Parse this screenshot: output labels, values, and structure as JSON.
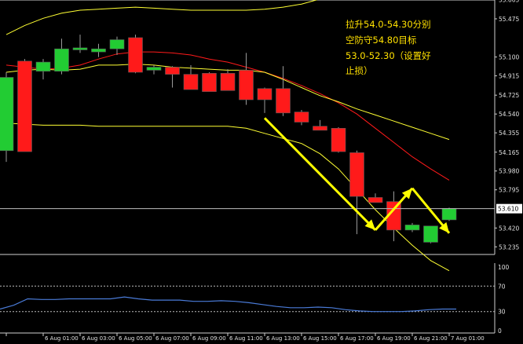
{
  "annotation": {
    "lines": [
      "拉升54.0-54.30分别",
      "空防守54.80目标",
      "53.0-52.30（设置好",
      "止损）"
    ],
    "color": "#ffe000"
  },
  "chart_data": {
    "type": "candlestick",
    "ylim": [
      53.16,
      55.66
    ],
    "price_ticks": [
      "55.665",
      "55.475",
      "55.100",
      "54.915",
      "54.725",
      "54.540",
      "54.355",
      "54.165",
      "53.980",
      "53.795",
      "53.610",
      "53.420",
      "53.235"
    ],
    "current_price": "53.610",
    "x_tick_labels": [
      "6 Aug 2019",
      "6 Aug 01:00",
      "6 Aug 03:00",
      "6 Aug 05:00",
      "6 Aug 07:00",
      "6 Aug 09:00",
      "6 Aug 11:00",
      "6 Aug 13:00",
      "6 Aug 15:00",
      "6 Aug 17:00",
      "6 Aug 19:00",
      "6 Aug 21:00",
      "7 Aug 01:00"
    ],
    "candles": [
      {
        "o": 54.18,
        "h": 54.95,
        "l": 54.07,
        "c": 54.9
      },
      {
        "o": 55.06,
        "h": 55.08,
        "l": 54.18,
        "c": 54.17
      },
      {
        "o": 54.96,
        "h": 55.08,
        "l": 54.88,
        "c": 55.05
      },
      {
        "o": 54.96,
        "h": 55.28,
        "l": 54.93,
        "c": 55.18
      },
      {
        "o": 55.17,
        "h": 55.32,
        "l": 55.14,
        "c": 55.19
      },
      {
        "o": 55.15,
        "h": 55.23,
        "l": 55.1,
        "c": 55.18
      },
      {
        "o": 55.18,
        "h": 55.3,
        "l": 55.12,
        "c": 55.27
      },
      {
        "o": 55.29,
        "h": 55.32,
        "l": 54.94,
        "c": 54.95
      },
      {
        "o": 54.97,
        "h": 55.02,
        "l": 54.93,
        "c": 55.0
      },
      {
        "o": 55.0,
        "h": 55.01,
        "l": 54.8,
        "c": 54.93
      },
      {
        "o": 54.93,
        "h": 55.02,
        "l": 54.78,
        "c": 54.78
      },
      {
        "o": 54.94,
        "h": 54.95,
        "l": 54.77,
        "c": 54.76
      },
      {
        "o": 54.94,
        "h": 54.98,
        "l": 54.78,
        "c": 54.77
      },
      {
        "o": 54.97,
        "h": 55.14,
        "l": 54.63,
        "c": 54.68
      },
      {
        "o": 54.79,
        "h": 54.8,
        "l": 54.55,
        "c": 54.68
      },
      {
        "o": 54.79,
        "h": 55.01,
        "l": 54.52,
        "c": 54.55
      },
      {
        "o": 54.56,
        "h": 54.58,
        "l": 54.43,
        "c": 54.46
      },
      {
        "o": 54.42,
        "h": 54.48,
        "l": 54.38,
        "c": 54.38
      },
      {
        "o": 54.4,
        "h": 54.41,
        "l": 54.16,
        "c": 54.17
      },
      {
        "o": 54.16,
        "h": 54.18,
        "l": 53.36,
        "c": 53.73
      },
      {
        "o": 53.72,
        "h": 53.76,
        "l": 53.67,
        "c": 53.67
      },
      {
        "o": 53.68,
        "h": 53.78,
        "l": 53.29,
        "c": 53.4
      },
      {
        "o": 53.4,
        "h": 53.47,
        "l": 53.38,
        "c": 53.45
      },
      {
        "o": 53.28,
        "h": 53.43,
        "l": 53.27,
        "c": 53.44
      },
      {
        "o": 53.5,
        "h": 53.62,
        "l": 53.49,
        "c": 53.61
      }
    ],
    "moving_averages": [
      {
        "name": "",
        "color": "#ff1a1a",
        "values": [
          55.02,
          55.0,
          54.98,
          54.99,
          55.02,
          55.08,
          55.13,
          55.15,
          55.15,
          55.14,
          55.12,
          55.08,
          55.05,
          55.0,
          54.95,
          54.89,
          54.82,
          54.74,
          54.65,
          54.54,
          54.4,
          54.26,
          54.12,
          54.0,
          53.89
        ]
      },
      {
        "name": "",
        "color": "#ffff33",
        "values": [
          55.32,
          55.41,
          55.48,
          55.53,
          55.56,
          55.57,
          55.58,
          55.59,
          55.58,
          55.57,
          55.56,
          55.56,
          55.56,
          55.56,
          55.57,
          55.59,
          55.62,
          55.67,
          55.69,
          55.7,
          55.71,
          55.71,
          55.71,
          55.71,
          55.71
        ]
      },
      {
        "name": "",
        "color": "#ffff33",
        "values": [
          54.95,
          54.97,
          54.98,
          54.97,
          54.98,
          55.02,
          55.02,
          55.03,
          55.02,
          55.0,
          54.99,
          54.98,
          54.97,
          54.97,
          54.95,
          54.88,
          54.8,
          54.72,
          54.66,
          54.59,
          54.53,
          54.47,
          54.41,
          54.35,
          54.29
        ]
      },
      {
        "name": "",
        "color": "#ffff33",
        "values": [
          54.45,
          54.44,
          54.43,
          54.43,
          54.43,
          54.42,
          54.42,
          54.42,
          54.42,
          54.42,
          54.42,
          54.42,
          54.42,
          54.4,
          54.35,
          54.3,
          54.25,
          54.15,
          54.0,
          53.8,
          53.6,
          53.42,
          53.25,
          53.1,
          53.0
        ]
      }
    ],
    "indicator": {
      "ylim": [
        0,
        100
      ],
      "levels": [
        "100",
        "70",
        "30",
        "0"
      ],
      "values": [
        34,
        40,
        50,
        49,
        49,
        50,
        50,
        50,
        50,
        53,
        50,
        48,
        48,
        48,
        46,
        46,
        47,
        46,
        44,
        41,
        38,
        36,
        36,
        37,
        36,
        33,
        31,
        30,
        30,
        30,
        31,
        33,
        34,
        34
      ],
      "color": "#4a7bd8",
      "level_color": "#bdbdbd"
    },
    "arrows": [
      {
        "from": [
          "6 Aug 13:00",
          54.5
        ],
        "to": [
          "6 Aug 19:00",
          53.4
        ]
      },
      {
        "from": [
          "6 Aug 19:00",
          53.4
        ],
        "to": [
          "6 Aug 21:00",
          53.81
        ]
      },
      {
        "from": [
          "6 Aug 21:00",
          53.81
        ],
        "to": [
          "7 Aug 01:00",
          53.37
        ]
      }
    ]
  }
}
